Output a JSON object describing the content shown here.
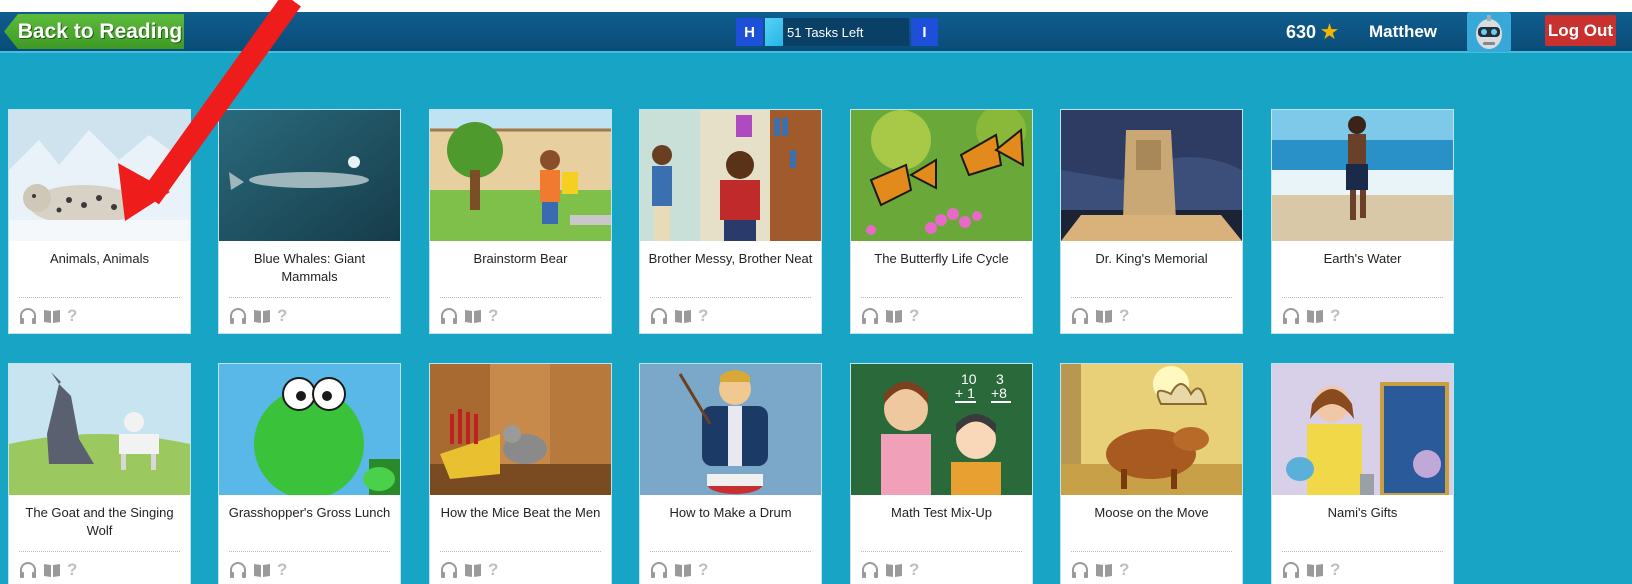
{
  "header": {
    "back_label": "Back to Reading",
    "level_left": "H",
    "level_right": "I",
    "tasks_left": "51 Tasks Left",
    "points": "630",
    "username": "Matthew",
    "logout_label": "Log Out"
  },
  "books": [
    {
      "title": "Animals, Animals",
      "scene": "snow-leopard"
    },
    {
      "title": "Blue Whales: Giant Mammals",
      "scene": "whale"
    },
    {
      "title": "Brainstorm Bear",
      "scene": "boy-yard"
    },
    {
      "title": "Brother Messy, Brother Neat",
      "scene": "brothers-room"
    },
    {
      "title": "The Butterfly Life Cycle",
      "scene": "butterflies"
    },
    {
      "title": "Dr. King's Memorial",
      "scene": "memorial"
    },
    {
      "title": "Earth's Water",
      "scene": "beach"
    },
    {
      "title": "The Goat and the Singing Wolf",
      "scene": "wolf-goat"
    },
    {
      "title": "Grasshopper's Gross Lunch",
      "scene": "grasshopper"
    },
    {
      "title": "How the Mice Beat the Men",
      "scene": "mouse"
    },
    {
      "title": "How to Make a Drum",
      "scene": "drummer"
    },
    {
      "title": "Math Test Mix-Up",
      "scene": "math-kids"
    },
    {
      "title": "Moose on the Move",
      "scene": "moose"
    },
    {
      "title": "Nami's Gifts",
      "scene": "girl-teapot"
    }
  ],
  "colors": {
    "background": "#18a4c4",
    "header": "#0a4c78",
    "back_button": "#4aa82d",
    "logout": "#c8312d",
    "level_badge": "#1e4fd8",
    "annotation_arrow": "#ef1c1c"
  }
}
